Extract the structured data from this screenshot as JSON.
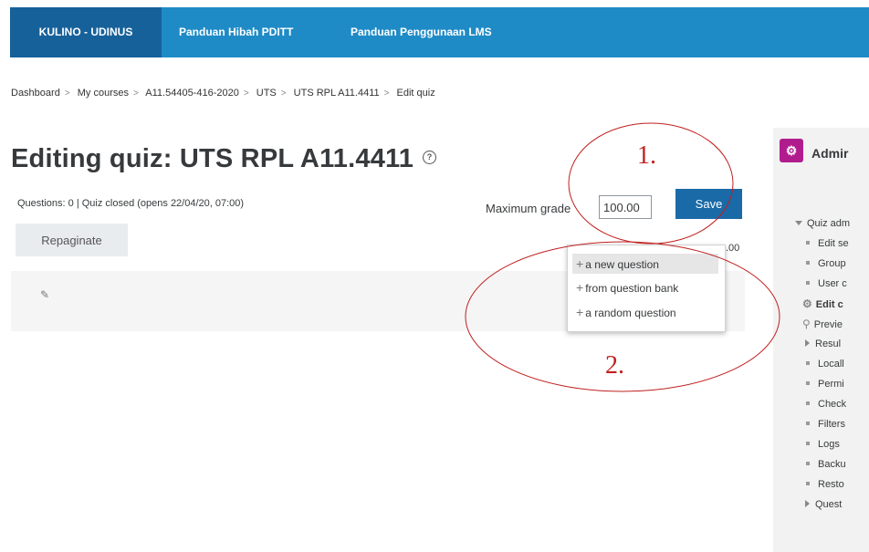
{
  "navbar": {
    "brand": "KULINO - UDINUS",
    "links": [
      "Panduan Hibah PDITT",
      "Panduan Penggunaan LMS"
    ]
  },
  "breadcrumb": [
    "Dashboard",
    "My courses",
    "A11.54405-416-2020",
    "UTS",
    "UTS RPL A11.4411",
    "Edit quiz"
  ],
  "page": {
    "title": "Editing quiz: UTS RPL A11.4411",
    "status": "Questions: 0 | Quiz closed (opens 22/04/20, 07:00)",
    "max_grade_label": "Maximum grade",
    "max_grade_value": "100.00",
    "save_label": "Save",
    "repaginate_label": "Repaginate",
    "total_marks": ".00"
  },
  "add_menu": {
    "items": [
      "a new question",
      "from question bank",
      "a random question"
    ],
    "active_index": 0
  },
  "annotations": {
    "label_1": "1.",
    "label_2": "2.",
    "color": "#c0201f"
  },
  "admin": {
    "title": "Admir",
    "items": [
      {
        "label": "Quiz adm",
        "type": "caret-down"
      },
      {
        "label": "Edit se",
        "type": "bullet"
      },
      {
        "label": "Group",
        "type": "bullet"
      },
      {
        "label": "User c",
        "type": "bullet"
      },
      {
        "label": "Edit c",
        "type": "gear"
      },
      {
        "label": "Previe",
        "type": "search"
      },
      {
        "label": "Resul",
        "type": "caret-right"
      },
      {
        "label": "Locall",
        "type": "bullet"
      },
      {
        "label": "Permi",
        "type": "bullet"
      },
      {
        "label": "Check",
        "type": "bullet"
      },
      {
        "label": "Filters",
        "type": "bullet"
      },
      {
        "label": "Logs",
        "type": "bullet"
      },
      {
        "label": "Backu",
        "type": "bullet"
      },
      {
        "label": "Resto",
        "type": "bullet"
      },
      {
        "label": "Quest",
        "type": "caret-right"
      }
    ]
  },
  "colors": {
    "navbar": "#1f8bc6",
    "brand": "#17619a",
    "save": "#196aa7",
    "admin_icon": "#b01c8e"
  }
}
